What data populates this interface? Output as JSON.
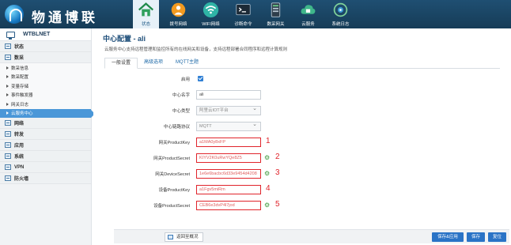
{
  "brand": {
    "name": "物通博联"
  },
  "nav": [
    {
      "label": "状态",
      "icon": "home-icon",
      "active": true
    },
    {
      "label": "拨号网络",
      "icon": "globe-icon"
    },
    {
      "label": "WIFI网络",
      "icon": "wifi-icon"
    },
    {
      "label": "诊断命令",
      "icon": "terminal-icon"
    },
    {
      "label": "数采网关",
      "icon": "gateway-icon"
    },
    {
      "label": "云服务",
      "icon": "cloud-icon"
    },
    {
      "label": "系统日志",
      "icon": "log-icon"
    }
  ],
  "sidebar": {
    "title": "WTBLNET",
    "groups": [
      {
        "label": "状态"
      },
      {
        "label": "数采",
        "items": [
          {
            "label": "数采信息"
          },
          {
            "label": "数采配置"
          },
          {
            "label": "变量存储"
          },
          {
            "label": "事件触发器"
          },
          {
            "label": "网关日志"
          },
          {
            "label": "云服务中心",
            "active": true
          }
        ]
      },
      {
        "label": "网络"
      },
      {
        "label": "转发"
      },
      {
        "label": "应用"
      },
      {
        "label": "系统"
      },
      {
        "label": "VPN"
      },
      {
        "label": "防火墙"
      }
    ]
  },
  "main": {
    "title": "中心配置 - ali",
    "description": "云服务中心支持远程管理和监控所有的在线网关和设备，支持远程部署合同程序和远程计算规则",
    "tabs": [
      {
        "label": "一般设置",
        "active": true
      },
      {
        "label": "高级选项"
      },
      {
        "label": "MQTT主题"
      }
    ],
    "form": {
      "enable_label": "启用",
      "enabled": true,
      "name_label": "中心名字",
      "name_value": "ali",
      "type_label": "中心类型",
      "type_value": "阿里云IOT平台",
      "protocol_label": "中心链路协议",
      "protocol_value": "MQTT",
      "gw_product_key_label": "网关ProductKey",
      "gw_product_key_value": "a1MA0y8xFP",
      "gw_product_secret_label": "网关ProductSecret",
      "gw_product_secret_value": "KIYV2K0uRwYQe8Z5",
      "gw_device_secret_label": "网关DeviceSecret",
      "gw_device_secret_value": "1e6e6bacbc6d33e9454d4208",
      "dev_product_key_label": "设备ProductKey",
      "dev_product_key_value": "a1Fgv5miRm",
      "dev_product_secret_label": "设备ProductSecret",
      "dev_product_secret_value": "CEB6e3dvP4l7jod",
      "markers": [
        "1",
        "2",
        "3",
        "4",
        "5"
      ]
    }
  },
  "footer": {
    "back_label": "返回至概况",
    "save_apply_label": "保存&应用",
    "save_label": "保存",
    "reset_label": "复位"
  },
  "colors": {
    "header": "#1f4f72",
    "accent": "#2a73c6",
    "active_menu": "#4a97d8",
    "annotation": "#e0242b"
  }
}
